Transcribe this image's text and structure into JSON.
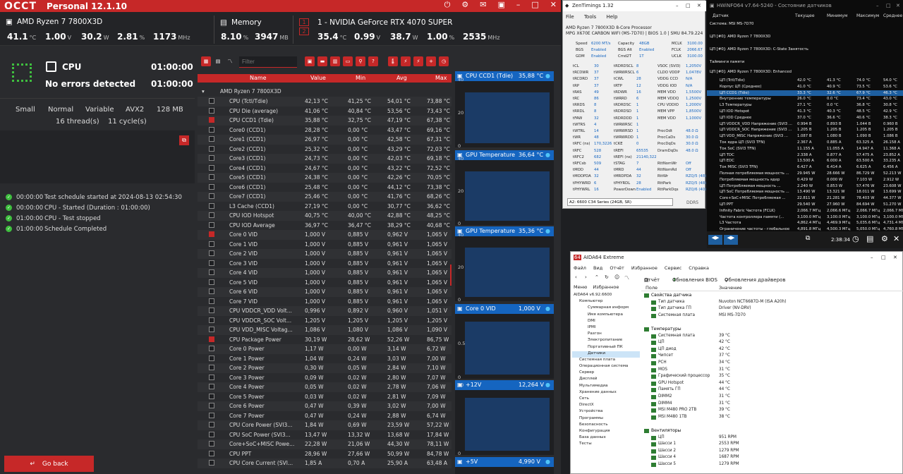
{
  "occt": {
    "title": "Personal 12.1.10",
    "logo": "OCCT",
    "cpu_name": "AMD Ryzen 7 7800X3D",
    "cpu_temp": "41.1",
    "cpu_temp_u": "°C",
    "cpu_volt": "1.00",
    "cpu_volt_u": "V",
    "cpu_power": "30.2",
    "cpu_power_u": "W",
    "cpu_load": "2.81",
    "cpu_load_u": "%",
    "cpu_clock": "1173",
    "cpu_clock_u": "MHz",
    "mem_label": "Memory",
    "mem_pct": "8.10",
    "mem_pct_u": "%",
    "mem_used": "3947",
    "mem_used_u": "MB",
    "gpu_n1": "1",
    "gpu_n2": "2",
    "gpu_name": "1 - NVIDIA GeForce RTX 4070 SUPER",
    "gpu_temp": "35.4",
    "gpu_temp_u": "°C",
    "gpu_volt": "0.99",
    "gpu_volt_u": "V",
    "gpu_power": "38.7",
    "gpu_power_u": "W",
    "gpu_load": "1.00",
    "gpu_load_u": "%",
    "gpu_clock": "2535",
    "gpu_clock_u": "MHz",
    "test_name": "CPU",
    "test_time1": "01:00:00",
    "status": "No errors detected",
    "test_time2": "01:00:00",
    "params": [
      "Small",
      "Normal",
      "Variable",
      "AVX2",
      "128 MB"
    ],
    "threads": "16 thread(s)",
    "cycles": "11 cycle(s)",
    "log": [
      {
        "t": "00:00:00",
        "m": "Test schedule started at 2024-08-13 02:54:30"
      },
      {
        "t": "00:00:00",
        "m": "CPU - Started (Duration : 01:00:00)"
      },
      {
        "t": "01:00:00",
        "m": "CPU - Test stopped"
      },
      {
        "t": "01:00:00",
        "m": "Schedule Completed"
      }
    ],
    "goback": "Go back",
    "filter_placeholder": "Filter",
    "grid_headers": {
      "name": "Name",
      "value": "Value",
      "min": "Min",
      "avg": "Avg",
      "max": "Max"
    },
    "grid_group": "AMD Ryzen 7 7800X3D",
    "rows": [
      [
        "CPU (Tctl/Tdie)",
        "42,13 °C",
        "41,25 °C",
        "54,01 °C",
        "73,88 °C",
        0
      ],
      [
        "CPU Die (average)",
        "41,06 °C",
        "40,84 °C",
        "53,56 °C",
        "73,43 °C",
        0
      ],
      [
        "CPU CCD1 (Tdie)",
        "35,88 °C",
        "32,75 °C",
        "47,19 °C",
        "67,38 °C",
        1
      ],
      [
        "Core0 (CCD1)",
        "28,28 °C",
        "0,00 °C",
        "43,47 °C",
        "69,16 °C",
        0
      ],
      [
        "Core1 (CCD1)",
        "26,97 °C",
        "0,00 °C",
        "42,58 °C",
        "67,31 °C",
        0
      ],
      [
        "Core2 (CCD1)",
        "25,32 °C",
        "0,00 °C",
        "43,29 °C",
        "72,03 °C",
        0
      ],
      [
        "Core3 (CCD1)",
        "24,73 °C",
        "0,00 °C",
        "42,03 °C",
        "69,18 °C",
        0
      ],
      [
        "Core4 (CCD1)",
        "24,67 °C",
        "0,00 °C",
        "43,22 °C",
        "72,52 °C",
        0
      ],
      [
        "Core5 (CCD1)",
        "24,38 °C",
        "0,00 °C",
        "42,26 °C",
        "70,05 °C",
        0
      ],
      [
        "Core6 (CCD1)",
        "25,48 °C",
        "0,00 °C",
        "44,12 °C",
        "73,38 °C",
        0
      ],
      [
        "Core7 (CCD1)",
        "25,46 °C",
        "0,00 °C",
        "41,76 °C",
        "68,26 °C",
        0
      ],
      [
        "L3 Cache (CCD1)",
        "27,19 °C",
        "0,00 °C",
        "30,77 °C",
        "36,62 °C",
        0
      ],
      [
        "CPU IOD Hotspot",
        "40,75 °C",
        "40,00 °C",
        "42,88 °C",
        "48,25 °C",
        0
      ],
      [
        "CPU IOD Average",
        "36,97 °C",
        "36,47 °C",
        "38,29 °C",
        "40,68 °C",
        0
      ],
      [
        "Core 0 VID",
        "1,000 V",
        "0,885 V",
        "0,962 V",
        "1,065 V",
        1
      ],
      [
        "Core 1 VID",
        "1,000 V",
        "0,885 V",
        "0,961 V",
        "1,065 V",
        0
      ],
      [
        "Core 2 VID",
        "1,000 V",
        "0,885 V",
        "0,961 V",
        "1,065 V",
        0
      ],
      [
        "Core 3 VID",
        "1,000 V",
        "0,885 V",
        "0,961 V",
        "1,065 V",
        0
      ],
      [
        "Core 4 VID",
        "1,000 V",
        "0,885 V",
        "0,961 V",
        "1,065 V",
        0
      ],
      [
        "Core 5 VID",
        "1,000 V",
        "0,885 V",
        "0,961 V",
        "1,065 V",
        0
      ],
      [
        "Core 6 VID",
        "1,000 V",
        "0,885 V",
        "0,961 V",
        "1,065 V",
        0
      ],
      [
        "Core 7 VID",
        "1,000 V",
        "0,885 V",
        "0,961 V",
        "1,065 V",
        0
      ],
      [
        "CPU VDDCR_VDD Volt...",
        "0,996 V",
        "0,892 V",
        "0,960 V",
        "1,051 V",
        0
      ],
      [
        "CPU VDDCR_SOC Volt...",
        "1,205 V",
        "1,205 V",
        "1,205 V",
        "1,205 V",
        0
      ],
      [
        "CPU VDD_MISC Voltag...",
        "1,086 V",
        "1,080 V",
        "1,086 V",
        "1,090 V",
        0
      ],
      [
        "CPU Package Power",
        "30,19 W",
        "28,62 W",
        "52,26 W",
        "86,75 W",
        1
      ],
      [
        "Core 0 Power",
        "1,17 W",
        "0,00 W",
        "3,14 W",
        "6,72 W",
        0
      ],
      [
        "Core 1 Power",
        "1,04 W",
        "0,24 W",
        "3,03 W",
        "7,00 W",
        0
      ],
      [
        "Core 2 Power",
        "0,30 W",
        "0,05 W",
        "2,84 W",
        "7,10 W",
        0
      ],
      [
        "Core 3 Power",
        "0,09 W",
        "0,02 W",
        "2,80 W",
        "7,07 W",
        0
      ],
      [
        "Core 4 Power",
        "0,05 W",
        "0,02 W",
        "2,78 W",
        "7,06 W",
        0
      ],
      [
        "Core 5 Power",
        "0,03 W",
        "0,02 W",
        "2,81 W",
        "7,09 W",
        0
      ],
      [
        "Core 6 Power",
        "0,47 W",
        "0,39 W",
        "3,02 W",
        "7,00 W",
        0
      ],
      [
        "Core 7 Power",
        "0,47 W",
        "0,24 W",
        "2,88 W",
        "6,74 W",
        0
      ],
      [
        "CPU Core Power (SVI3...",
        "1,84 W",
        "0,69 W",
        "23,59 W",
        "57,22 W",
        0
      ],
      [
        "CPU SoC Power (SVI3...",
        "13,47 W",
        "13,32 W",
        "13,68 W",
        "17,84 W",
        0
      ],
      [
        "Core+SoC+MISC Powe...",
        "22,28 W",
        "21,06 W",
        "44,30 W",
        "78,11 W",
        0
      ],
      [
        "CPU PPT",
        "28,96 W",
        "27,66 W",
        "50,99 W",
        "84,78 W",
        0
      ],
      [
        "CPU Core Current (SVI...",
        "1,85 A",
        "0,70 A",
        "25,90 A",
        "63,48 A",
        0
      ]
    ],
    "graphs": [
      {
        "name": "CPU CCD1 (Tdie)",
        "value": "35,88 °C",
        "ticks": [
          "40",
          "20",
          "0"
        ]
      },
      {
        "name": "GPU Temperature",
        "value": "36,64 °C",
        "ticks": [
          "40",
          "20",
          "0"
        ]
      },
      {
        "name": "GPU Temperature",
        "value": "35,36 °C",
        "ticks": [
          "40",
          "20",
          "0"
        ]
      },
      {
        "name": "Core 0 VID",
        "value": "1,000 V",
        "ticks": [
          "1",
          "0.5",
          "0"
        ]
      },
      {
        "name": "+12V",
        "value": "12,264 V",
        "ticks": [
          "10",
          "0"
        ]
      },
      {
        "name": "+5V",
        "value": "4,990 V",
        "ticks": []
      }
    ]
  },
  "zen": {
    "title": "ZenTimings 1.32",
    "menu": [
      "File",
      "Tools",
      "Help"
    ],
    "cpu": "AMD Ryzen 7 7800X3D 8-Core Processor",
    "board": "MPG X670E CARBON WIFI (MS-7D70) | BIOS 1.0 | SMU 84.79.224",
    "top": [
      [
        "Speed",
        "6200 MT/s",
        "Capacity",
        "48GB",
        "MCLK",
        "3100.00"
      ],
      [
        "BGS",
        "Enabled",
        "BGS Alt",
        "Enabled",
        "FCLK",
        "2066.67"
      ],
      [
        "GDM",
        "Enabled",
        "Cmd2T",
        "1T",
        "UCLK",
        "3100.00"
      ]
    ],
    "rows": [
      [
        "tCL",
        "30",
        "tRDRDSCL",
        "8",
        "VSOC (SVI3)",
        "1,2050V"
      ],
      [
        "tRCDWR",
        "37",
        "tWRWRSCL",
        "6",
        "CLDO VDDP",
        "1,0478V"
      ],
      [
        "tRCDRD",
        "37",
        "tCWL",
        "28",
        "VDDG CCD",
        "N/A"
      ],
      [
        "tRP",
        "37",
        "tRTP",
        "12",
        "VDDG IOD",
        "N/A"
      ],
      [
        "tRAS",
        "49",
        "tRDWR",
        "16",
        "MEM VDD",
        "1,5500V"
      ],
      [
        "tRC",
        "86",
        "tWRRD",
        "6",
        "MEM VDDQ",
        "1,2500V"
      ],
      [
        "tRRDS",
        "8",
        "tRDRDSC",
        "1",
        "CPU VDDIO",
        "1,2000V"
      ],
      [
        "tRRDL",
        "8",
        "tRDRDSD",
        "1",
        "MEM VPP",
        "1,8500V"
      ],
      [
        "tFAW",
        "32",
        "tRDRDDD",
        "1",
        "MEM VDD",
        "1,1000V"
      ],
      [
        "tWTRS",
        "4",
        "tWRWRSC",
        "1",
        "",
        ""
      ],
      [
        "tWTRL",
        "14",
        "tWRWRSD",
        "1",
        "ProcOdt",
        "48.0 Ω"
      ],
      [
        "tWR",
        "48",
        "tWRWRDD",
        "1",
        "ProcCaDs",
        "30.0 Ω"
      ],
      [
        "tRFC (ns)",
        "170,3226",
        "tCKE",
        "0",
        "ProcDqDs",
        "30.0 Ω"
      ],
      [
        "tRFC",
        "528",
        "tREFI",
        "65535",
        "DramDqDs",
        "48.0 Ω"
      ],
      [
        "tRFC2",
        "682",
        "tREFI (ns)",
        "21140,322",
        "",
        ""
      ],
      [
        "tRFCsb",
        "509",
        "tSTAG",
        "7",
        "RttNomWr",
        "Off"
      ],
      [
        "tMOD",
        "44",
        "tMRD",
        "44",
        "RttNomRd",
        "Off"
      ],
      [
        "tMODPDA",
        "32",
        "tMRDPDA",
        "32",
        "RttWr",
        "RZQ/5 (48)"
      ],
      [
        "tPHYWRD",
        "6",
        "tPHYRDL",
        "28",
        "RttPark",
        "RZQ/5 (48)"
      ],
      [
        "tPHYWRL",
        "16",
        "PowerDown",
        "Enabled",
        "RttParkDqs",
        "RZQ/6 (40)"
      ]
    ],
    "module": "A2: 6600 C34 Series (24GB, SR)",
    "ddr": "DDR5"
  },
  "hw": {
    "title": "HWiNFO64 v7.64-5240 - Состояние датчиков",
    "headers": [
      "Датчик",
      "Текущее",
      "Минимум",
      "Максимум",
      "Среднее"
    ],
    "groups": [
      "Система: MSI MS-7D70",
      "ЦП [#0]: AMD Ryzen 7 7800X3D",
      "ЦП [#0]: AMD Ryzen 7 7800X3D: C-State Занятость",
      "Тайминги памяти",
      "ЦП [#0]: AMD Ryzen 7 7800X3D: Enhanced"
    ],
    "rows": [
      [
        "ЦП (Tctl/Tdie)",
        "42.0 °C",
        "41.3 °C",
        "74.0 °C",
        "54.0 °C"
      ],
      [
        "Корпус ЦП (Среднее)",
        "41.0 °C",
        "40.9 °C",
        "73.5 °C",
        "53.6 °C"
      ],
      [
        "ЦП CCD1 (Tdie)",
        "33.3 °C",
        "32.6 °C",
        "67.9 °C",
        "46.3 °C"
      ],
      [
        "Внутренние температуры",
        "26.0 °C",
        "0.0 °C",
        "73.4 °C",
        "43.0 °C"
      ],
      [
        "L3 Температуры",
        "27.1 °C",
        "0.0 °C",
        "36.8 °C",
        "30.8 °C"
      ],
      [
        "ЦП IOD Hotspot",
        "41.3 °C",
        "40.3 °C",
        "48.5 °C",
        "42.9 °C"
      ],
      [
        "ЦП IOD Среднее",
        "37.0 °C",
        "36.6 °C",
        "40.6 °C",
        "38.3 °C"
      ],
      [
        "ЦП VDDCR_VDD Напряжение (SVI3 ...",
        "0.994 В",
        "0.893 В",
        "1.044 В",
        "0.960 В"
      ],
      [
        "ЦП VDDCR_SOC Напряжение (SVI3 ...",
        "1.205 В",
        "1.205 В",
        "1.205 В",
        "1.205 В"
      ],
      [
        "ЦП VDD_MISC Напряжение (SVI3 ...",
        "1.087 В",
        "1.080 В",
        "1.090 В",
        "1.086 В"
      ],
      [
        "Ток ядра ЦП (SVI3 TFN)",
        "2.367 A",
        "0.885 A",
        "63.325 A",
        "26.158 A"
      ],
      [
        "Ток SoC (SVI3 TFN)",
        "11.155 A",
        "11.055 A",
        "14.947 A",
        "11.368 A"
      ],
      [
        "ЦП TDC",
        "2.338 A",
        "0.877 A",
        "57.475 A",
        "23.852 A"
      ],
      [
        "ЦП EDC",
        "13.500 A",
        "6.000 A",
        "63.500 A",
        "33.235 A"
      ],
      [
        "Ток MISC (SVI3 TFN)",
        "6.427 A",
        "6.414 A",
        "6.625 A",
        "6.456 A"
      ],
      [
        "Полная потребляемая мощность ...",
        "29.945 W",
        "28.666 W",
        "86.729 W",
        "52.213 W"
      ],
      [
        "Потребляемая мощность ядер",
        "0.429 W",
        "0.000 W",
        "7.103 W",
        "2.912 W"
      ],
      [
        "ЦП Потребляемая мощность ...",
        "2.240 W",
        "0.853 W",
        "57.476 W",
        "23.608 W"
      ],
      [
        "ЦП SoC Потребляемая мощность ...",
        "13.490 W",
        "13.321 W",
        "18.011 W",
        "13.699 W"
      ],
      [
        "Core+SoC+MISC Потребляемая ...",
        "22.811 W",
        "21.281 W",
        "78.403 W",
        "44.377 W"
      ],
      [
        "ЦП PPT",
        "29.540 W",
        "27.960 W",
        "84.694 W",
        "51.270 W"
      ],
      [
        "Infinity Fabric Частота (FCLK)",
        "2,066.7 МГц",
        "2,066.6 МГц",
        "2,066.7 МГц",
        "2,066.7 МГц"
      ],
      [
        "Частота контроллера памяти (...",
        "3,100.0 МГц",
        "3,100.0 МГц",
        "3,100.0 МГц",
        "3,100.0 МГц"
      ],
      [
        "L3 Частота",
        "4,862.4 МГц",
        "4,469.9 МГц",
        "5,035.6 МГц",
        "4,731.4 МГц"
      ],
      [
        "Ограничение частоты - глобальное",
        "4,891.8 МГц",
        "4,500.3 МГц",
        "5,050.0 МГц",
        "4,760.8 МГц"
      ]
    ],
    "clock": "2:38:34"
  },
  "aida": {
    "title": "AIDA64 Extreme",
    "menu": [
      "Файл",
      "Вид",
      "Отчёт",
      "Избранное",
      "Сервис",
      "Справка"
    ],
    "tool_report": "Отчёт",
    "tool_bios": "Обновления BIOS",
    "tool_drivers": "Обновления драйверов",
    "tabs": [
      "Меню",
      "Избранное"
    ],
    "col_field": "Поле",
    "col_value": "Значение",
    "tree": [
      "AIDA64 v6.92.6600",
      "Компьютер",
      "Суммарная информ",
      "Имя компьютера",
      "DMI",
      "IPMI",
      "Разгон",
      "Электропитание",
      "Портативный ПК",
      "Датчики",
      "Системная плата",
      "Операционная система",
      "Сервер",
      "Дисплей",
      "Мультимедиа",
      "Хранение данных",
      "Сеть",
      "DirectX",
      "Устройства",
      "Программы",
      "Безопасность",
      "Конфигурация",
      "База данных",
      "Тесты"
    ],
    "rows": [
      [
        "Свойства датчика",
        "",
        1
      ],
      [
        "Тип датчика",
        "Nuvoton NCT6687D-M  (ISA A20h)",
        0
      ],
      [
        "Тип датчика ГП",
        "Driver  (NV-DRV)",
        0
      ],
      [
        "Системная плата",
        "MSI MS-7D70",
        0
      ],
      [
        "",
        "",
        2
      ],
      [
        "Температуры",
        "",
        1
      ],
      [
        "Системная плата",
        "39 °C",
        0
      ],
      [
        "ЦП",
        "42 °C",
        0
      ],
      [
        "ЦП диод",
        "42 °C",
        0
      ],
      [
        "Чипсет",
        "37 °C",
        0
      ],
      [
        "PCH",
        "34 °C",
        0
      ],
      [
        "MOS",
        "31 °C",
        0
      ],
      [
        "Графический процессор",
        "35 °C",
        0
      ],
      [
        "GPU Hotspot",
        "44 °C",
        0
      ],
      [
        "Память ГП",
        "44 °C",
        0
      ],
      [
        "DIMM2",
        "31 °C",
        0
      ],
      [
        "DIMM4",
        "31 °C",
        0
      ],
      [
        "MSI M480 PRO 2TB",
        "39 °C",
        0
      ],
      [
        "MSI M480 1TB",
        "38 °C",
        0
      ],
      [
        "",
        "",
        2
      ],
      [
        "Вентиляторы",
        "",
        1
      ],
      [
        "ЦП",
        "951 RPM",
        0
      ],
      [
        "Шасси 1",
        "2553 RPM",
        0
      ],
      [
        "Шасси 2",
        "1279 RPM",
        0
      ],
      [
        "Шасси 4",
        "1687 RPM",
        0
      ],
      [
        "Шасси 5",
        "1279 RPM",
        0
      ]
    ]
  }
}
